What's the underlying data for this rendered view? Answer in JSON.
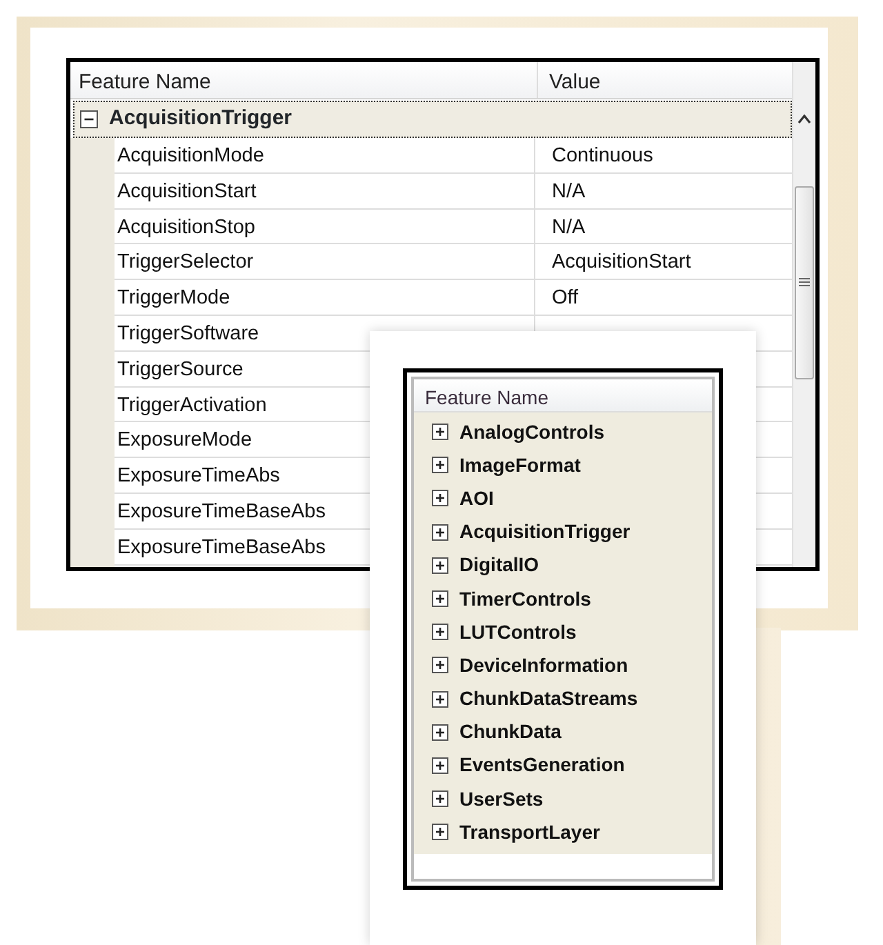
{
  "property_grid": {
    "columns": [
      "Feature Name",
      "Value"
    ],
    "group": {
      "label": "AcquisitionTrigger",
      "expanded": true
    },
    "rows": [
      {
        "name": "AcquisitionMode",
        "value": "Continuous"
      },
      {
        "name": "AcquisitionStart",
        "value": "N/A"
      },
      {
        "name": "AcquisitionStop",
        "value": "N/A"
      },
      {
        "name": "TriggerSelector",
        "value": "AcquisitionStart"
      },
      {
        "name": "TriggerMode",
        "value": "Off"
      },
      {
        "name": "TriggerSoftware"
      },
      {
        "name": "TriggerSource"
      },
      {
        "name": "TriggerActivation"
      },
      {
        "name": "ExposureMode"
      },
      {
        "name": "ExposureTimeAbs"
      },
      {
        "name": "ExposureTimeBaseAbs"
      },
      {
        "name": "ExposureTimeBaseAbs"
      }
    ]
  },
  "category_list": {
    "column": "Feature Name",
    "items": [
      {
        "label": "AnalogControls",
        "expanded": false
      },
      {
        "label": "ImageFormat",
        "expanded": false
      },
      {
        "label": "AOI",
        "expanded": false
      },
      {
        "label": "AcquisitionTrigger",
        "expanded": false
      },
      {
        "label": "DigitalIO",
        "expanded": false
      },
      {
        "label": "TimerControls",
        "expanded": false
      },
      {
        "label": "LUTControls",
        "expanded": false
      },
      {
        "label": "DeviceInformation",
        "expanded": false
      },
      {
        "label": "ChunkDataStreams",
        "expanded": false
      },
      {
        "label": "ChunkData",
        "expanded": false
      },
      {
        "label": "EventsGeneration",
        "expanded": false
      },
      {
        "label": "UserSets",
        "expanded": false
      },
      {
        "label": "TransportLayer",
        "expanded": false
      }
    ]
  }
}
